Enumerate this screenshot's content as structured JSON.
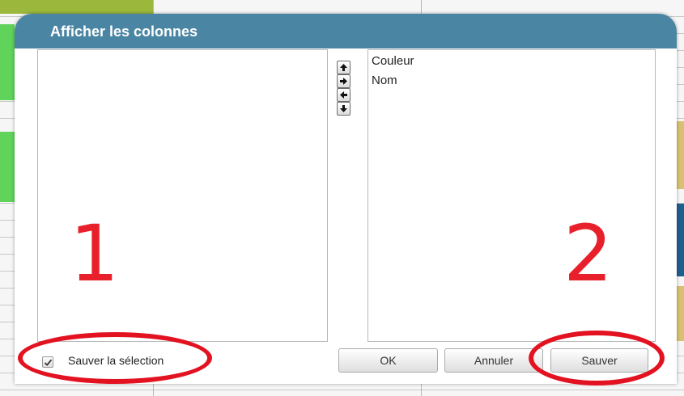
{
  "dialog": {
    "title": "Afficher les colonnes",
    "left_list": {
      "items": []
    },
    "right_list": {
      "items": [
        "Couleur",
        "Nom"
      ]
    },
    "arrow_buttons": [
      {
        "icon": "arrow-up-icon"
      },
      {
        "icon": "arrow-right-icon"
      },
      {
        "icon": "arrow-left-icon"
      },
      {
        "icon": "arrow-down-icon"
      }
    ],
    "save_selection": {
      "label": "Sauver la sélection",
      "checked": true
    },
    "buttons": {
      "ok": "OK",
      "cancel": "Annuler",
      "save": "Sauver"
    }
  },
  "annotations": {
    "label_1": "1",
    "label_2": "2",
    "color": "#e31221"
  },
  "colors": {
    "titlebar": "#4a86a3",
    "bg_green": "#5fd35a",
    "bg_yellow": "#d9c173",
    "bg_blue": "#1f5f8c",
    "bg_olive": "#9cb83c"
  }
}
